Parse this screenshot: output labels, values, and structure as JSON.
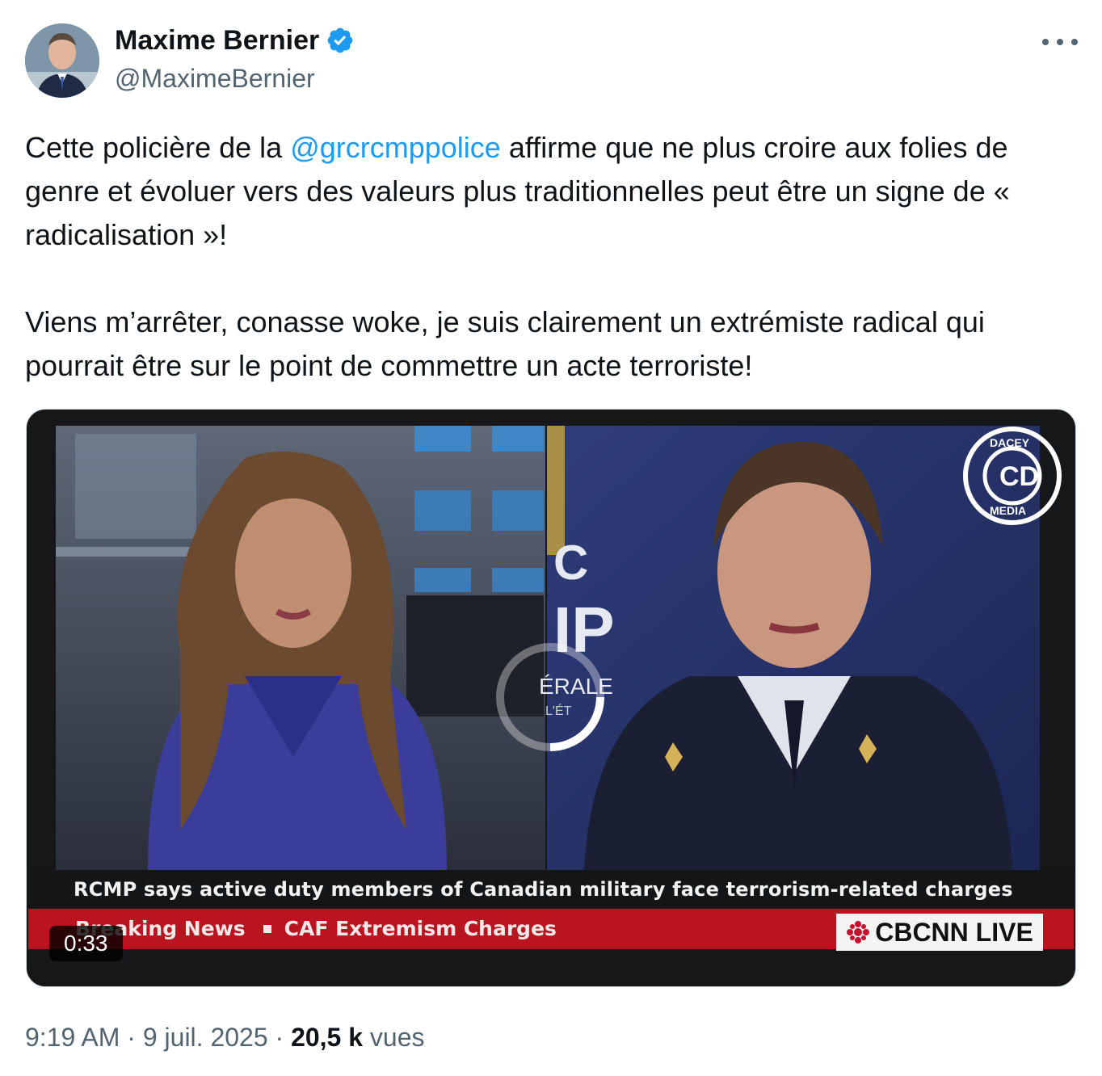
{
  "author": {
    "name": "Maxime Bernier",
    "handle": "@MaximeBernier",
    "verified": true
  },
  "tweet": {
    "p1_before": "Cette policière de la ",
    "p1_mention": "@grcrcmppolice",
    "p1_after": " affirme que ne plus croire aux folies de genre et évoluer vers des valeurs plus traditionnelles peut être un signe de « radicalisation »!",
    "p2": "Viens m’arrêter, conasse woke, je suis clairement un extrémiste radical qui pourrait être sur le point de commettre un acte terroriste!"
  },
  "video": {
    "headline": "RCMP says active duty members of Canadian military face terrorism-related charges",
    "breaking_label": "Breaking News",
    "breaking_topic": "CAF Extremism Charges",
    "network": "CBCNN LIVE",
    "duration": "0:33",
    "watermark": "DACEY MEDIA",
    "backdrop_fragments": [
      "C",
      "IP",
      "ÉRALE",
      "L'ÉT"
    ]
  },
  "footer": {
    "time": "9:19 AM",
    "sep1": " · ",
    "date": "9 juil. 2025",
    "sep2": " · ",
    "views_count": "20,5 k",
    "views_label": " vues"
  },
  "colors": {
    "link": "#1d9bf0",
    "verified": "#1d9bf0",
    "muted": "#536471",
    "breaking_red": "#b9141f"
  },
  "icons": [
    "verified-badge-icon",
    "more-options-icon",
    "cbc-gem-icon",
    "loading-spinner-icon"
  ]
}
